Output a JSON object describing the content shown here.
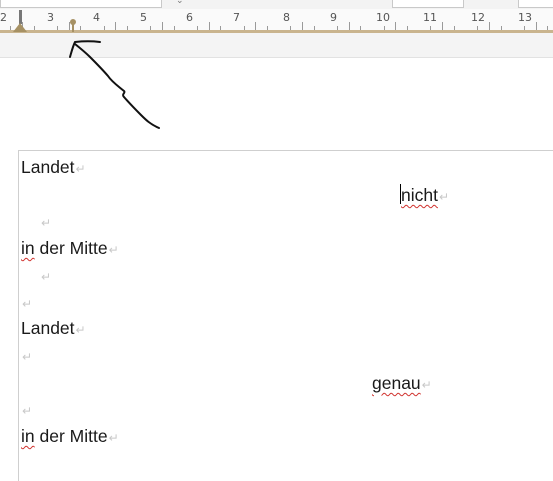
{
  "ruler": {
    "numbers": [
      "2",
      "3",
      "4",
      "5",
      "6",
      "7",
      "8",
      "9",
      "10",
      "11",
      "12",
      "13"
    ]
  },
  "document": {
    "lines": [
      {
        "text": "Landet",
        "mark": "↵"
      },
      {
        "text": "nicht",
        "mark": "↵"
      },
      {
        "text": "",
        "mark": "↵"
      },
      {
        "word1": "in",
        "rest": " der Mitte",
        "mark": "↵"
      },
      {
        "text": "",
        "mark": "↵"
      },
      {
        "text": "",
        "mark": "↵"
      },
      {
        "text": "Landet",
        "mark": "↵"
      },
      {
        "text": "",
        "mark": "↵"
      },
      {
        "text": "genau",
        "mark": "↵"
      },
      {
        "text": "",
        "mark": "↵"
      },
      {
        "word1": "in",
        "rest": " der Mitte",
        "mark": "↵"
      }
    ]
  },
  "colors": {
    "ruler_accent": "#c9b48e",
    "spell_underline": "#d0312d",
    "formatting_mark": "#c8c8c8"
  },
  "annotation": {
    "type": "hand-drawn-arrow",
    "target": "tab-stop"
  }
}
